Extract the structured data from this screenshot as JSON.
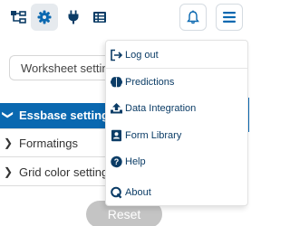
{
  "colors": {
    "accent": "#0a68b0",
    "toolbar_icon": "#0b3c66",
    "menu_text": "#0b3c66",
    "reset_bg": "#c4c4c4"
  },
  "toolbar": {
    "icons": [
      "hierarchy-icon",
      "gear-icon",
      "plug-icon",
      "table-icon",
      "bell-icon",
      "hamburger-menu-icon"
    ]
  },
  "worksheet": {
    "placeholder": "Worksheet setting"
  },
  "sections": {
    "essbase": {
      "label": "Essbase settings",
      "chevron": "❯",
      "expanded": true
    },
    "formatings": {
      "label": "Formatings",
      "chevron": "❯"
    },
    "grid_color": {
      "label": "Grid color setting",
      "chevron": "❯"
    }
  },
  "reset": {
    "label": "Reset"
  },
  "menu": {
    "logout": {
      "label": "Log out",
      "icon": "logout-icon"
    },
    "predictions": {
      "label": "Predictions",
      "icon": "brain-icon"
    },
    "data_integration": {
      "label": "Data Integration",
      "icon": "upload-icon"
    },
    "form_library": {
      "label": "Form Library",
      "icon": "address-book-icon"
    },
    "help": {
      "label": "Help",
      "icon": "question-circle-icon"
    },
    "about": {
      "label": "About",
      "icon": "q-logo-icon"
    }
  }
}
